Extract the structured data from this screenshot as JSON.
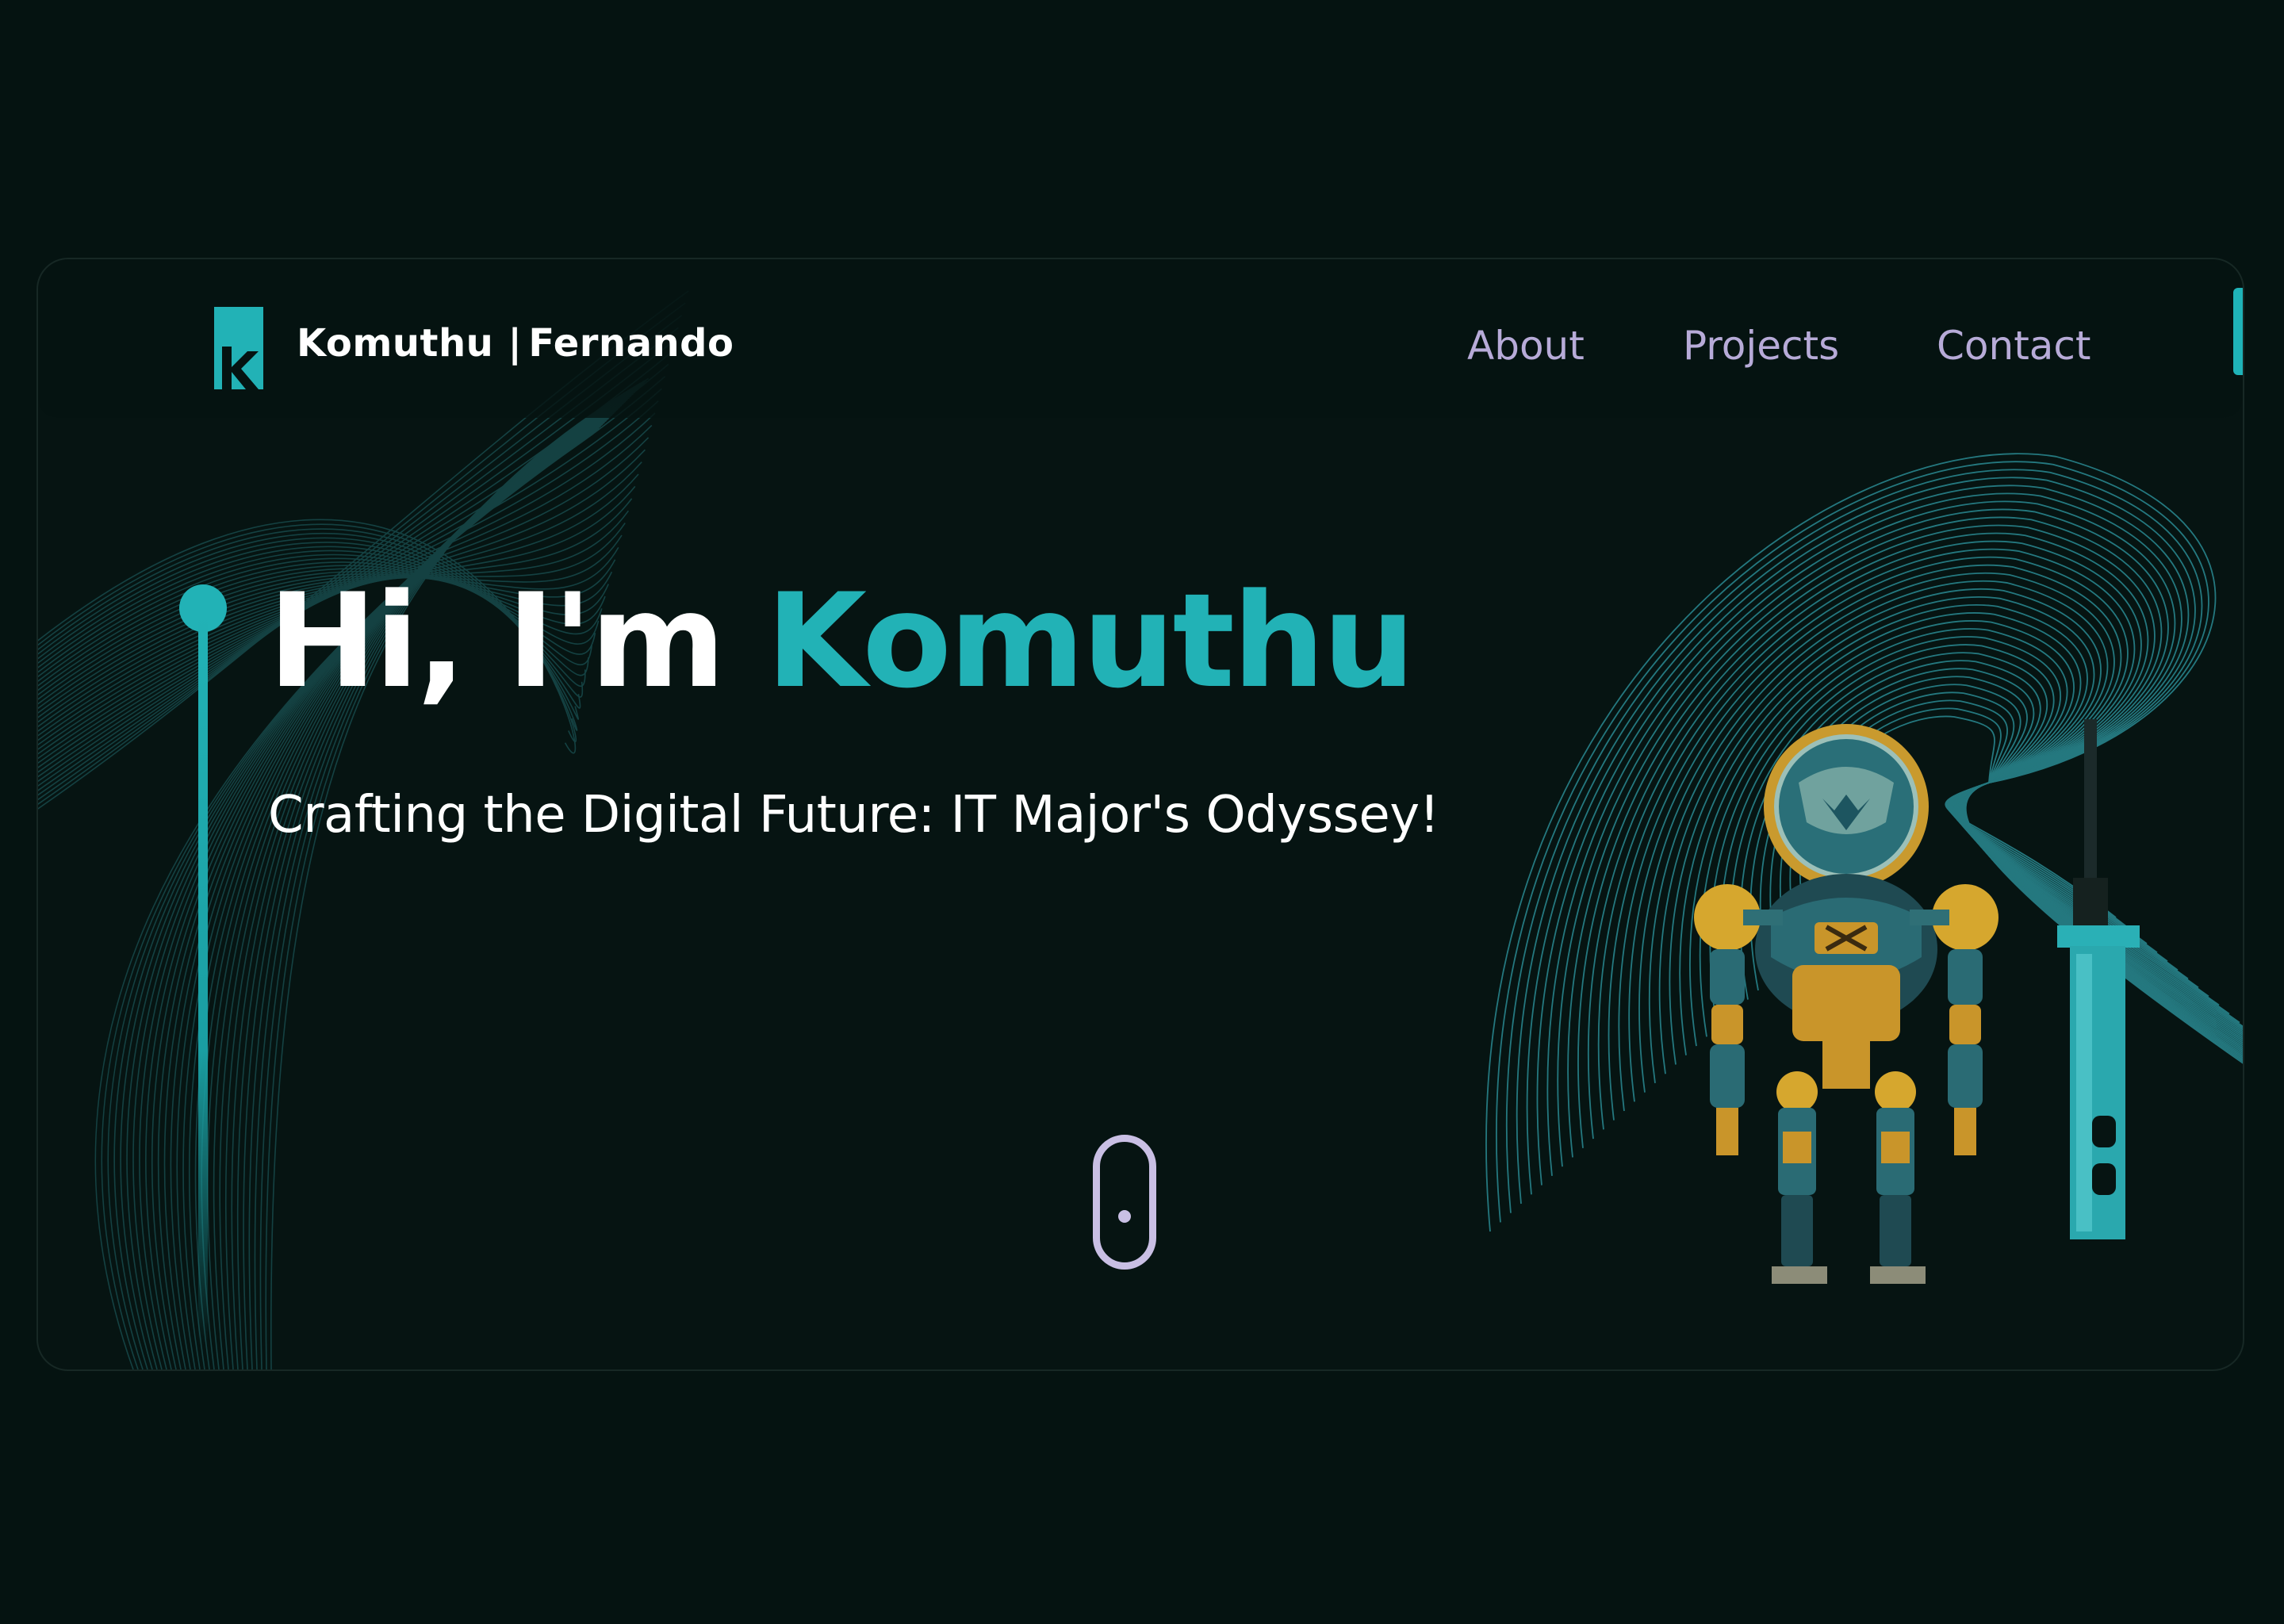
{
  "header": {
    "logo_icon": "k-logo-icon",
    "brand_first": "Komuthu",
    "brand_separator": "|",
    "brand_last": "Fernando"
  },
  "nav": {
    "items": [
      {
        "label": "About"
      },
      {
        "label": "Projects"
      },
      {
        "label": "Contact"
      }
    ]
  },
  "hero": {
    "greeting": "Hi, I'm",
    "name": "Komuthu",
    "tagline": "Crafting the Digital Future: IT Major's Odyssey!"
  },
  "scroll_indicator": {
    "icon": "mouse-scroll-icon"
  },
  "illustration": {
    "subject": "robot-illustration"
  },
  "colors": {
    "background": "#051311",
    "accent": "#22b2b6",
    "nav_text": "#b7abd8",
    "heading": "#ffffff",
    "scroll_icon": "#c9bfe4",
    "wave_lines": "#2a8f98"
  }
}
